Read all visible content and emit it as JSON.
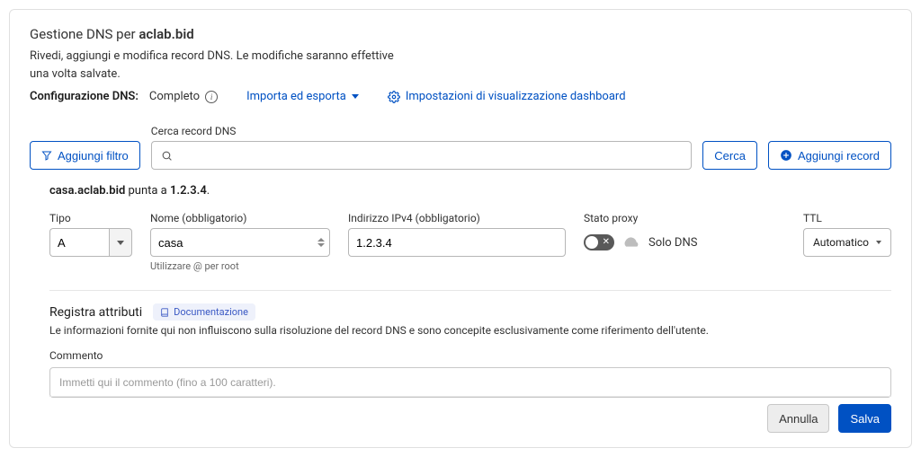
{
  "header": {
    "title_prefix": "Gestione DNS per ",
    "domain": "aclab.bid",
    "subtitle": "Rivedi, aggiungi e modifica record DNS. Le modifiche saranno effettive una volta salvate.",
    "config_label": "Configurazione DNS:",
    "config_value": "Completo",
    "import_export": "Importa ed esporta",
    "dashboard_settings": "Impostazioni di visualizzazione dashboard"
  },
  "toolbar": {
    "add_filter": "Aggiungi filtro",
    "search_label": "Cerca record DNS",
    "search_value": "",
    "search_btn": "Cerca",
    "add_record": "Aggiungi record"
  },
  "summary": {
    "host": "casa.aclab.bid",
    "middle": " punta a ",
    "target": "1.2.3.4",
    "suffix": "."
  },
  "form": {
    "type_label": "Tipo",
    "type_value": "A",
    "name_label": "Nome (obbligatorio)",
    "name_value": "casa",
    "name_hint": "Utilizzare @ per root",
    "ipv4_label": "Indirizzo IPv4 (obbligatorio)",
    "ipv4_value": "1.2.3.4",
    "proxy_label": "Stato proxy",
    "proxy_text": "Solo DNS",
    "ttl_label": "TTL",
    "ttl_value": "Automatico"
  },
  "attrs": {
    "title": "Registra attributi",
    "doc_badge": "Documentazione",
    "description": "Le informazioni fornite qui non influiscono sulla risoluzione del record DNS e sono concepite esclusivamente come riferimento dell'utente.",
    "comment_label": "Commento",
    "comment_placeholder": "Immetti qui il commento (fino a 100 caratteri)."
  },
  "footer": {
    "cancel": "Annulla",
    "save": "Salva"
  }
}
